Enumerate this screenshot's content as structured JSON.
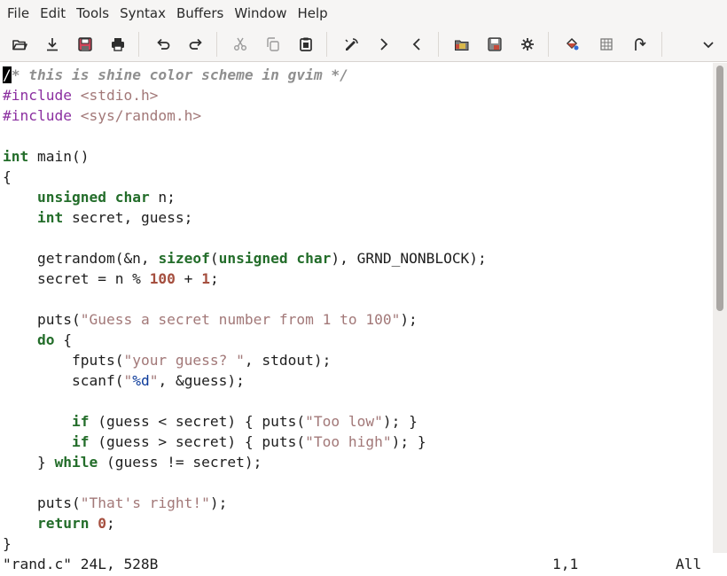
{
  "menu": [
    "File",
    "Edit",
    "Tools",
    "Syntax",
    "Buffers",
    "Window",
    "Help"
  ],
  "toolbar": {
    "buttons": [
      {
        "name": "open-icon"
      },
      {
        "name": "save-download-icon"
      },
      {
        "name": "save-all-icon"
      },
      {
        "name": "print-icon"
      },
      {
        "name": "undo-icon"
      },
      {
        "name": "redo-icon"
      },
      {
        "name": "cut-icon"
      },
      {
        "name": "copy-icon"
      },
      {
        "name": "paste-icon"
      },
      {
        "name": "find-replace-icon"
      },
      {
        "name": "find-next-icon"
      },
      {
        "name": "find-previous-icon"
      },
      {
        "name": "load-session-icon"
      },
      {
        "name": "save-session-icon"
      },
      {
        "name": "run-script-icon"
      },
      {
        "name": "make-icon"
      },
      {
        "name": "run-ctags-icon"
      },
      {
        "name": "jump-to-tag-icon"
      },
      {
        "name": "overflow-chevron-icon"
      }
    ]
  },
  "editor": {
    "cursor_char": "/",
    "lines": [
      [
        [
          "cursor",
          "/"
        ],
        [
          "comment",
          "* this is shine color scheme in gvim */"
        ]
      ],
      [
        [
          "pre",
          "#include "
        ],
        [
          "inc",
          "<stdio.h>"
        ]
      ],
      [
        [
          "pre",
          "#include "
        ],
        [
          "inc",
          "<sys/random.h>"
        ]
      ],
      [],
      [
        [
          "type",
          "int"
        ],
        [
          "plain",
          " main()"
        ]
      ],
      [
        [
          "plain",
          "{"
        ]
      ],
      [
        [
          "plain",
          "    "
        ],
        [
          "type",
          "unsigned"
        ],
        [
          "plain",
          " "
        ],
        [
          "type",
          "char"
        ],
        [
          "plain",
          " n;"
        ]
      ],
      [
        [
          "plain",
          "    "
        ],
        [
          "type",
          "int"
        ],
        [
          "plain",
          " secret, guess;"
        ]
      ],
      [],
      [
        [
          "plain",
          "    getrandom(&n, "
        ],
        [
          "kw",
          "sizeof"
        ],
        [
          "plain",
          "("
        ],
        [
          "type",
          "unsigned"
        ],
        [
          "plain",
          " "
        ],
        [
          "type",
          "char"
        ],
        [
          "plain",
          "), GRND_NONBLOCK);"
        ]
      ],
      [
        [
          "plain",
          "    secret = n % "
        ],
        [
          "num",
          "100"
        ],
        [
          "plain",
          " + "
        ],
        [
          "num",
          "1"
        ],
        [
          "plain",
          ";"
        ]
      ],
      [],
      [
        [
          "plain",
          "    puts("
        ],
        [
          "str",
          "\"Guess a secret number from 1 to 100\""
        ],
        [
          "plain",
          ");"
        ]
      ],
      [
        [
          "plain",
          "    "
        ],
        [
          "kw",
          "do"
        ],
        [
          "plain",
          " {"
        ]
      ],
      [
        [
          "plain",
          "        fputs("
        ],
        [
          "str",
          "\"your guess? \""
        ],
        [
          "plain",
          ", stdout);"
        ]
      ],
      [
        [
          "plain",
          "        scanf("
        ],
        [
          "str",
          "\""
        ],
        [
          "fmt",
          "%d"
        ],
        [
          "str",
          "\""
        ],
        [
          "plain",
          ", &guess);"
        ]
      ],
      [],
      [
        [
          "plain",
          "        "
        ],
        [
          "kw",
          "if"
        ],
        [
          "plain",
          " (guess < secret) { puts("
        ],
        [
          "str",
          "\"Too low\""
        ],
        [
          "plain",
          "); }"
        ]
      ],
      [
        [
          "plain",
          "        "
        ],
        [
          "kw",
          "if"
        ],
        [
          "plain",
          " (guess > secret) { puts("
        ],
        [
          "str",
          "\"Too high\""
        ],
        [
          "plain",
          "); }"
        ]
      ],
      [
        [
          "plain",
          "    } "
        ],
        [
          "kw",
          "while"
        ],
        [
          "plain",
          " (guess != secret);"
        ]
      ],
      [],
      [
        [
          "plain",
          "    puts("
        ],
        [
          "str",
          "\"That's right!\""
        ],
        [
          "plain",
          ");"
        ]
      ],
      [
        [
          "plain",
          "    "
        ],
        [
          "kw",
          "return"
        ],
        [
          "plain",
          " "
        ],
        [
          "num",
          "0"
        ],
        [
          "plain",
          ";"
        ]
      ],
      [
        [
          "plain",
          "}"
        ]
      ]
    ]
  },
  "status": {
    "file": "\"rand.c\" 24L, 528B",
    "position": "1,1",
    "scroll": "All"
  },
  "colors": {
    "comment": "#8f8f8f",
    "preprocessor": "#8b2fa0",
    "include_path": "#a27878",
    "type_keyword": "#236d2a",
    "string": "#a27878",
    "number": "#a54f3f",
    "format_spec": "#0b3a9a",
    "chrome_bg": "#f6f5f4"
  }
}
